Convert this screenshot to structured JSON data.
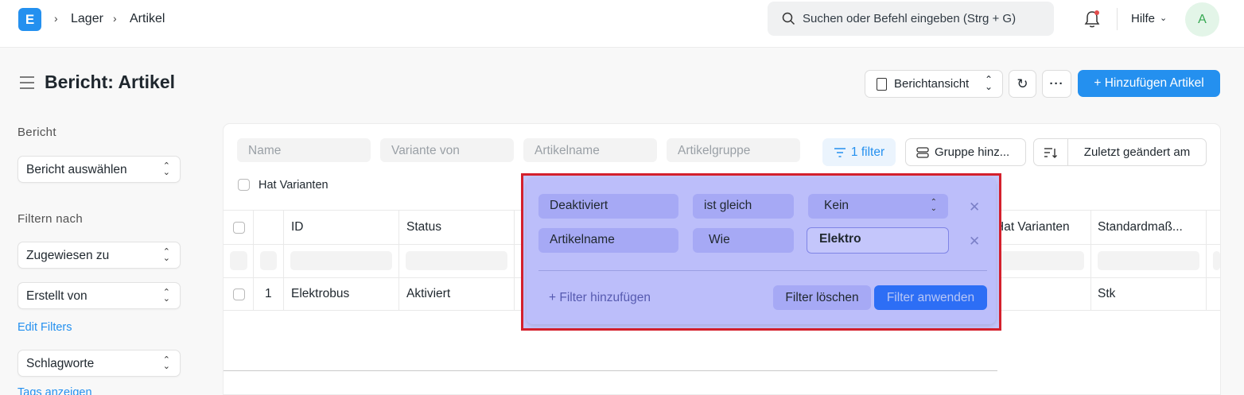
{
  "breadcrumb": {
    "logo": "E",
    "items": [
      "Lager",
      "Artikel"
    ]
  },
  "search": {
    "placeholder": "Suchen oder Befehl eingeben (Strg + G)"
  },
  "navbar": {
    "help_label": "Hilfe",
    "avatar_initial": "A"
  },
  "page": {
    "title": "Bericht: Artikel"
  },
  "toolbar": {
    "view_label": "Berichtansicht",
    "more_label": "···",
    "add_label": "+ Hinzufügen Artikel"
  },
  "sidebar": {
    "report_heading": "Bericht",
    "report_select": "Bericht auswählen",
    "filter_heading": "Filtern nach",
    "assigned_select": "Zugewiesen zu",
    "created_select": "Erstellt von",
    "edit_filters": "Edit Filters",
    "tags_select": "Schlagworte",
    "show_tags": "Tags anzeigen"
  },
  "filters": {
    "name_placeholder": "Name",
    "variant_placeholder": "Variante von",
    "item_name_placeholder": "Artikelname",
    "item_group_placeholder": "Artikelgruppe",
    "filter_button": "1 filter",
    "group_button": "Gruppe hinz...",
    "sort_label": "Zuletzt geändert am",
    "has_variants": "Hat Varianten"
  },
  "table": {
    "columns": [
      "ID",
      "Status",
      "Hat Varianten",
      "Standardmaß..."
    ],
    "rows": [
      {
        "index": "1",
        "id": "Elektrobus",
        "status": "Aktiviert",
        "uom": "Stk"
      }
    ]
  },
  "filter_popup": {
    "rows": [
      {
        "field": "Deaktiviert",
        "condition": "ist gleich",
        "value": "Kein"
      },
      {
        "field": "Artikelname",
        "condition": "Wie",
        "value": "Elektro"
      }
    ],
    "add_label": "+ Filter hinzufügen",
    "clear_label": "Filter löschen",
    "apply_label": "Filter anwenden"
  },
  "colors": {
    "accent": "#2490ef",
    "highlight_border": "#d4202c",
    "popup_overlay": "#bcbefa"
  }
}
